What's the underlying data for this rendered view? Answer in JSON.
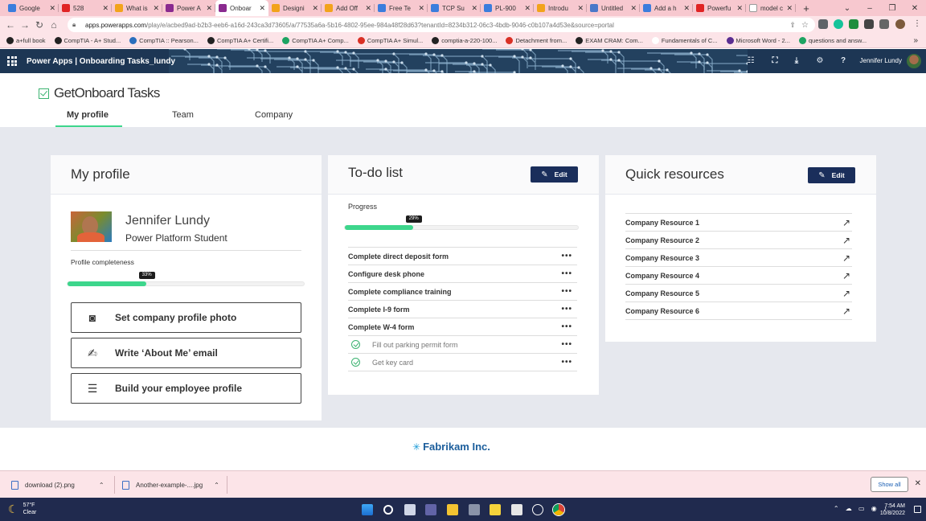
{
  "browser": {
    "tabs": [
      {
        "title": "Google",
        "color": "#3b7ddd"
      },
      {
        "title": "528",
        "color": "#e02424",
        "extra": "◀ ×"
      },
      {
        "title": "What is",
        "color": "#f2a31b"
      },
      {
        "title": "Power A",
        "color": "#8a2a8f"
      },
      {
        "title": "Onboar",
        "color": "#8a2a8f",
        "active": true
      },
      {
        "title": "Designi",
        "color": "#f2a31b"
      },
      {
        "title": "Add Off",
        "color": "#f2a31b"
      },
      {
        "title": "Free Te",
        "color": "#3b7ddd"
      },
      {
        "title": "TCP Su",
        "color": "#3b7ddd"
      },
      {
        "title": "PL-900",
        "color": "#3b7ddd"
      },
      {
        "title": "Introdu",
        "color": "#f2a31b"
      },
      {
        "title": "Untitled",
        "color": "#4a78c9"
      },
      {
        "title": "Add a h",
        "color": "#3b7ddd"
      },
      {
        "title": "Powerfu",
        "color": "#e02424"
      },
      {
        "title": "model c",
        "color": "#ffffff"
      }
    ],
    "new_tab": "+",
    "url_host": "apps.powerapps.com",
    "url_path": "/play/e/acbed9ad-b2b3-eeb6-a16d-243ca3d73605/a/77535a6a-5b16-4802-95ee-984a48f28d63?tenantId=8234b312-06c3-4bdb-9046-c0b107a4d53e&source=portal",
    "bookmarks": [
      {
        "label": "a+full book",
        "color": "#222"
      },
      {
        "label": "CompTIA - A+ Stud...",
        "color": "#222"
      },
      {
        "label": "CompTIA :: Pearson...",
        "color": "#2a6fbd"
      },
      {
        "label": "CompTIA A+ Certifi...",
        "color": "#222"
      },
      {
        "label": "CompTIA A+ Comp...",
        "color": "#1da462"
      },
      {
        "label": "CompTIA A+ Simul...",
        "color": "#d93025"
      },
      {
        "label": "comptia-a-220-100...",
        "color": "#222"
      },
      {
        "label": "Detachment from...",
        "color": "#d93025"
      },
      {
        "label": "EXAM CRAM: Com...",
        "color": "#222"
      },
      {
        "label": "Fundamentals of C...",
        "color": "#ffffff"
      },
      {
        "label": "Microsoft Word - 2...",
        "color": "#5a2d91"
      },
      {
        "label": "questions and answ...",
        "color": "#1da462"
      }
    ],
    "bookmarks_more": "»"
  },
  "powerapps": {
    "title": "Power Apps  |  Onboarding Tasks_lundy",
    "user": "Jennifer Lundy"
  },
  "app": {
    "name": "GetOnboard Tasks",
    "tabs": [
      "My profile",
      "Team",
      "Company"
    ]
  },
  "profile": {
    "title": "My profile",
    "name": "Jennifer Lundy",
    "role": "Power Platform Student",
    "completeness_label": "Profile completeness",
    "completeness_pct": 33,
    "completeness_badge": "33%",
    "actions": [
      {
        "label": "Set company profile photo",
        "icon": "camera-icon",
        "glyph": "◙"
      },
      {
        "label": "Write ‘About Me’ email",
        "icon": "compose-icon",
        "glyph": "✍"
      },
      {
        "label": "Build your employee profile",
        "icon": "person-list-icon",
        "glyph": "☰"
      }
    ]
  },
  "todo": {
    "title": "To-do list",
    "edit": "Edit",
    "progress_label": "Progress",
    "progress_pct": 29,
    "progress_badge": "29%",
    "items": [
      {
        "label": "Complete direct deposit form",
        "done": false
      },
      {
        "label": "Configure desk phone",
        "done": false
      },
      {
        "label": "Complete compliance training",
        "done": false
      },
      {
        "label": "Complete I-9 form",
        "done": false
      },
      {
        "label": "Complete W-4 form",
        "done": false
      },
      {
        "label": "Fill out parking permit form",
        "done": true
      },
      {
        "label": "Get key card",
        "done": true
      }
    ],
    "more": "•••"
  },
  "resources": {
    "title": "Quick resources",
    "edit": "Edit",
    "items": [
      "Company Resource 1",
      "Company Resource 2",
      "Company Resource 3",
      "Company Resource 4",
      "Company Resource 5",
      "Company Resource 6"
    ],
    "arrow": "↗"
  },
  "footer": {
    "brand": "Fabrikam Inc.",
    "brand_mark": "✳"
  },
  "downloads": {
    "files": [
      "download (2).png",
      "Another-example-....jpg"
    ],
    "show_all": "Show all"
  },
  "taskbar": {
    "temp": "57°F",
    "condition": "Clear",
    "time": "7:54 AM",
    "date": "10/8/2022"
  }
}
